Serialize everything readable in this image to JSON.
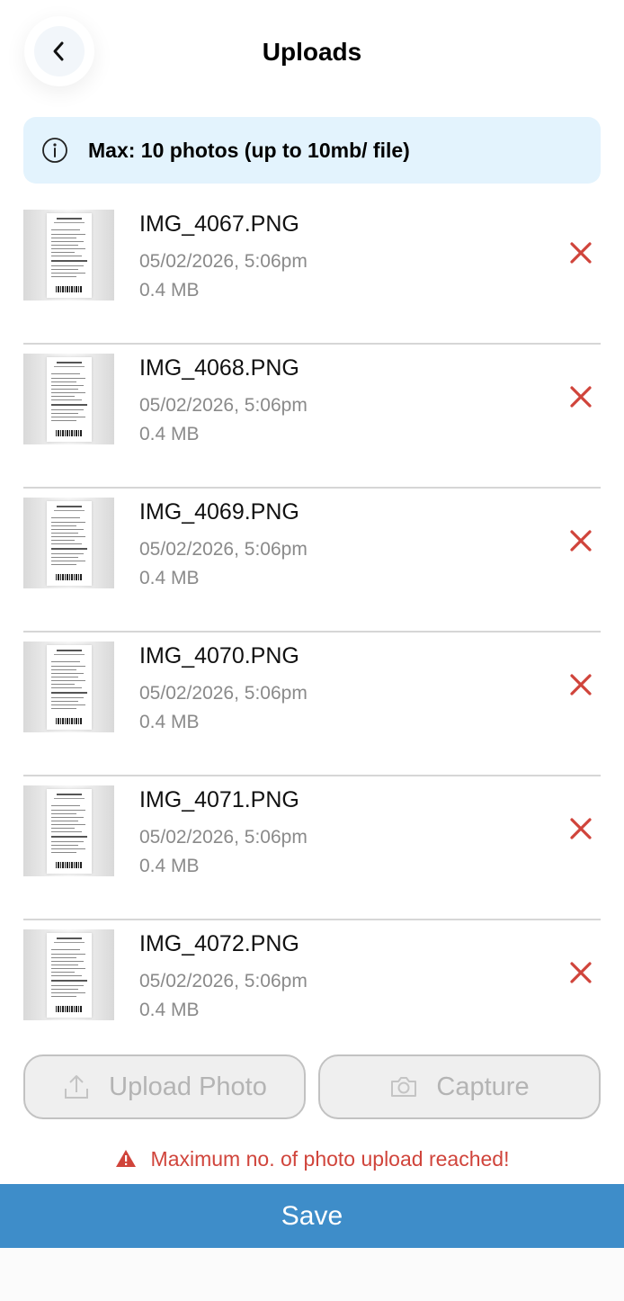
{
  "header": {
    "title": "Uploads",
    "back_icon": "chevron-left-icon"
  },
  "info": {
    "icon": "info-circle-icon",
    "text": "Max: 10 photos (up to 10mb/ file)"
  },
  "files": [
    {
      "name": "IMG_4067.PNG",
      "date": "05/02/2026, 5:06pm",
      "size": "0.4 MB"
    },
    {
      "name": "IMG_4068.PNG",
      "date": "05/02/2026, 5:06pm",
      "size": "0.4 MB"
    },
    {
      "name": "IMG_4069.PNG",
      "date": "05/02/2026, 5:06pm",
      "size": "0.4 MB"
    },
    {
      "name": "IMG_4070.PNG",
      "date": "05/02/2026, 5:06pm",
      "size": "0.4 MB"
    },
    {
      "name": "IMG_4071.PNG",
      "date": "05/02/2026, 5:06pm",
      "size": "0.4 MB"
    },
    {
      "name": "IMG_4072.PNG",
      "date": "05/02/2026, 5:06pm",
      "size": "0.4 MB"
    }
  ],
  "actions": {
    "upload_label": "Upload Photo",
    "capture_label": "Capture",
    "upload_icon": "upload-icon",
    "capture_icon": "camera-icon"
  },
  "warning": {
    "icon": "warning-triangle-icon",
    "text": "Maximum no. of photo upload reached!"
  },
  "save_label": "Save",
  "colors": {
    "accent": "#3e8dc9",
    "danger": "#d0443b",
    "info_bg": "#e3f3fd",
    "disabled_bg": "#efefef",
    "muted_text": "#8a8a8a"
  }
}
